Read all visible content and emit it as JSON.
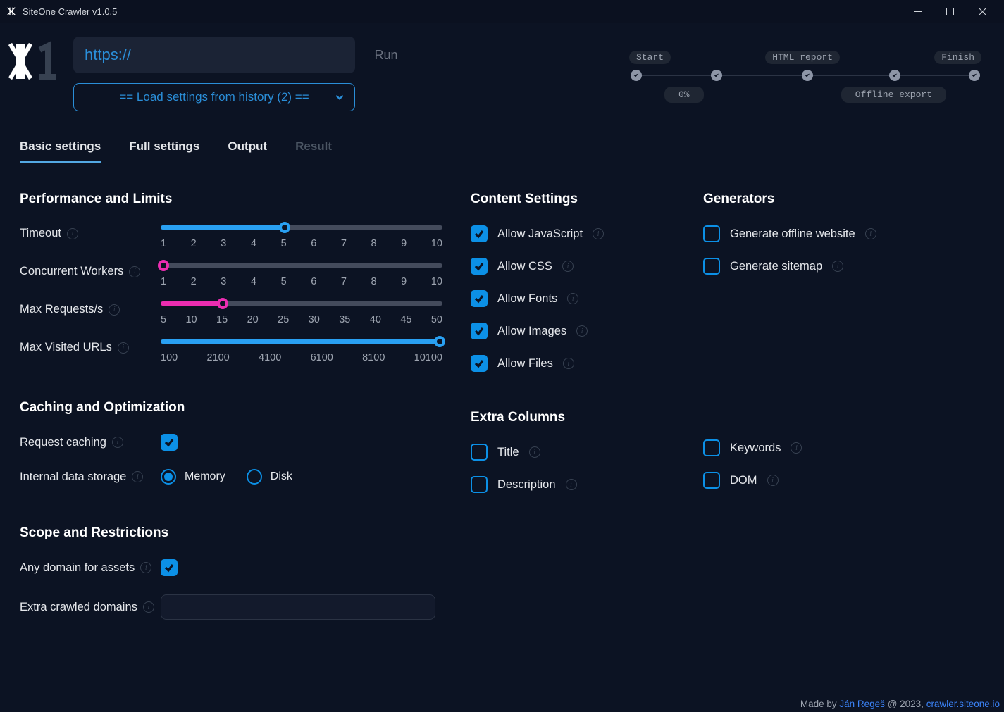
{
  "window": {
    "title": "SiteOne Crawler v1.0.5"
  },
  "header": {
    "url_placeholder": "https://",
    "url_value": "",
    "run_label": "Run",
    "history_label": "== Load settings from history (2) =="
  },
  "stepper": {
    "top": [
      "Start",
      "HTML report",
      "Finish"
    ],
    "bottom": [
      "0%",
      "Offline export"
    ]
  },
  "tabs": [
    {
      "label": "Basic settings",
      "active": true
    },
    {
      "label": "Full settings"
    },
    {
      "label": "Output"
    },
    {
      "label": "Result",
      "disabled": true
    }
  ],
  "perf": {
    "heading": "Performance and Limits",
    "timeout": {
      "label": "Timeout",
      "pct": 44,
      "ticks": [
        "1",
        "2",
        "3",
        "4",
        "5",
        "6",
        "7",
        "8",
        "9",
        "10"
      ]
    },
    "workers": {
      "label": "Concurrent Workers",
      "pct": 0,
      "ticks": [
        "1",
        "2",
        "3",
        "4",
        "5",
        "6",
        "7",
        "8",
        "9",
        "10"
      ]
    },
    "rps": {
      "label": "Max Requests/s",
      "pct": 22,
      "ticks": [
        "5",
        "10",
        "15",
        "20",
        "25",
        "30",
        "35",
        "40",
        "45",
        "50"
      ]
    },
    "urls": {
      "label": "Max Visited URLs",
      "pct": 100,
      "ticks": [
        "100",
        "2100",
        "4100",
        "6100",
        "8100",
        "10100"
      ]
    }
  },
  "cache": {
    "heading": "Caching and Optimization",
    "req_label": "Request caching",
    "storage_label": "Internal data storage",
    "memory": "Memory",
    "disk": "Disk"
  },
  "scope": {
    "heading": "Scope and Restrictions",
    "anydomain": "Any domain for assets",
    "extra": "Extra crawled domains"
  },
  "content": {
    "heading": "Content Settings",
    "items": [
      "Allow JavaScript",
      "Allow CSS",
      "Allow Fonts",
      "Allow Images",
      "Allow Files"
    ]
  },
  "extracols": {
    "heading": "Extra Columns",
    "left": [
      "Title",
      "Description"
    ],
    "right": [
      "Keywords",
      "DOM"
    ]
  },
  "gen": {
    "heading": "Generators",
    "items": [
      "Generate offline website",
      "Generate sitemap"
    ]
  },
  "footer": {
    "made": "Made by ",
    "author": "Ján Regeš",
    "mid": " @ 2023, ",
    "site": "crawler.siteone.io"
  }
}
